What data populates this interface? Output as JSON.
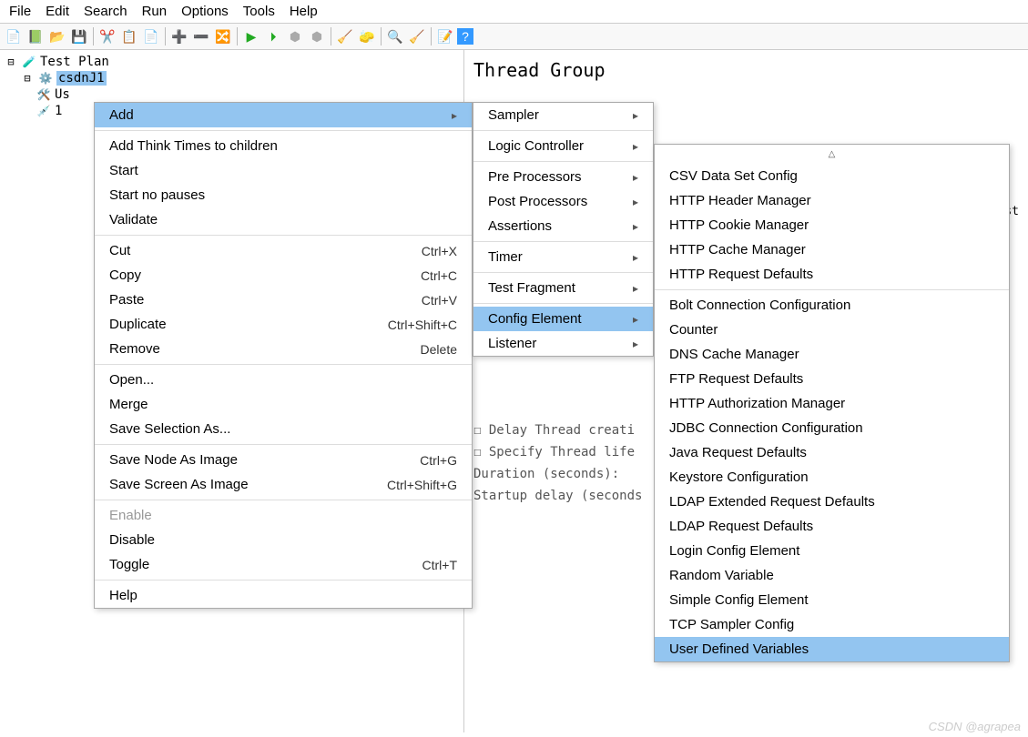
{
  "menubar": [
    "File",
    "Edit",
    "Search",
    "Run",
    "Options",
    "Tools",
    "Help"
  ],
  "tree": {
    "root": "Test Plan",
    "thread_group": "csdnJ1",
    "child1_prefix": "Us",
    "child2": "1"
  },
  "panel": {
    "title": "Thread Group",
    "delay": "Delay Thread creati",
    "specify": "Specify Thread life",
    "duration": "Duration (seconds):",
    "startup": "Startup delay (seconds",
    "name_suffix": "st"
  },
  "ctx1": {
    "add": "Add",
    "think": "Add Think Times to children",
    "start": "Start",
    "startno": "Start no pauses",
    "validate": "Validate",
    "cut": {
      "l": "Cut",
      "s": "Ctrl+X"
    },
    "copy": {
      "l": "Copy",
      "s": "Ctrl+C"
    },
    "paste": {
      "l": "Paste",
      "s": "Ctrl+V"
    },
    "dup": {
      "l": "Duplicate",
      "s": "Ctrl+Shift+C"
    },
    "remove": {
      "l": "Remove",
      "s": "Delete"
    },
    "open": "Open...",
    "merge": "Merge",
    "savesel": "Save Selection As...",
    "savenode": {
      "l": "Save Node As Image",
      "s": "Ctrl+G"
    },
    "savescreen": {
      "l": "Save Screen As Image",
      "s": "Ctrl+Shift+G"
    },
    "enable": "Enable",
    "disable": "Disable",
    "toggle": {
      "l": "Toggle",
      "s": "Ctrl+T"
    },
    "help": "Help"
  },
  "ctx2": {
    "sampler": "Sampler",
    "logic": "Logic Controller",
    "prepro": "Pre Processors",
    "postpro": "Post Processors",
    "assert": "Assertions",
    "timer": "Timer",
    "testfrag": "Test Fragment",
    "config": "Config Element",
    "listener": "Listener"
  },
  "ctx3": [
    "CSV Data Set Config",
    "HTTP Header Manager",
    "HTTP Cookie Manager",
    "HTTP Cache Manager",
    "HTTP Request Defaults",
    "",
    "Bolt Connection Configuration",
    "Counter",
    "DNS Cache Manager",
    "FTP Request Defaults",
    "HTTP Authorization Manager",
    "JDBC Connection Configuration",
    "Java Request Defaults",
    "Keystore Configuration",
    "LDAP Extended Request Defaults",
    "LDAP Request Defaults",
    "Login Config Element",
    "Random Variable",
    "Simple Config Element",
    "TCP Sampler Config",
    "User Defined Variables"
  ],
  "watermark": "CSDN @agrapea"
}
